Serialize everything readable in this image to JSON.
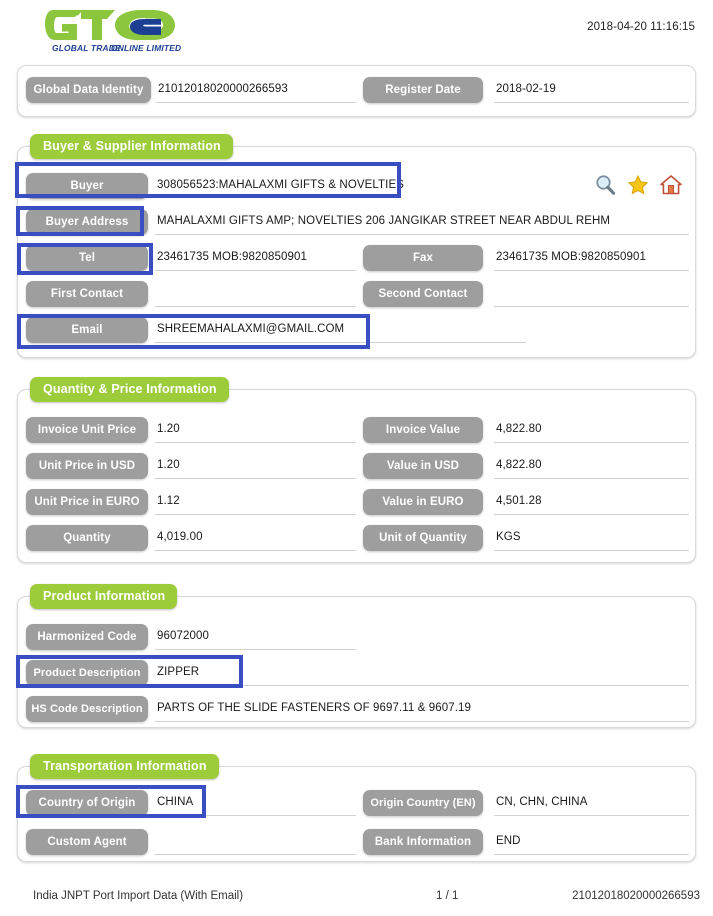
{
  "header": {
    "logo_text_top": "GTO",
    "logo_tagline": "GLOBAL TRADE ONLINE LIMITED",
    "timestamp": "2018-04-20 11:16:15"
  },
  "identity_card": {
    "fields": [
      {
        "label": "Global Data Identity",
        "value": "21012018020000266593"
      },
      {
        "label": "Register Date",
        "value": "2018-02-19"
      }
    ]
  },
  "buyer_section": {
    "title": "Buyer & Supplier Information",
    "fields": [
      {
        "label": "Buyer",
        "value": "308056523:MAHALAXMI GIFTS & NOVELTIES"
      },
      {
        "label": "Buyer Address",
        "value": "MAHALAXMI GIFTS AMP; NOVELTIES 206 JANGIKAR STREET NEAR ABDUL REHM"
      },
      {
        "label": "Tel",
        "value": "23461735 MOB:9820850901"
      },
      {
        "label": "Fax",
        "value": "23461735 MOB:9820850901"
      },
      {
        "label": "First Contact",
        "value": ""
      },
      {
        "label": "Second Contact",
        "value": ""
      },
      {
        "label": "Email",
        "value": "SHREEMAHALAXMI@GMAIL.COM"
      }
    ],
    "actions": [
      {
        "name": "search-icon",
        "title": "Search"
      },
      {
        "name": "star-icon",
        "title": "Favorite"
      },
      {
        "name": "home-icon",
        "title": "Home"
      }
    ]
  },
  "quantity_section": {
    "title": "Quantity & Price Information",
    "fields": [
      {
        "label": "Invoice Unit Price",
        "value": "1.20"
      },
      {
        "label": "Invoice Value",
        "value": "4,822.80"
      },
      {
        "label": "Unit Price in USD",
        "value": "1.20"
      },
      {
        "label": "Value in USD",
        "value": "4,822.80"
      },
      {
        "label": "Unit Price in EURO",
        "value": "1.12"
      },
      {
        "label": "Value in EURO",
        "value": "4,501.28"
      },
      {
        "label": "Quantity",
        "value": "4,019.00"
      },
      {
        "label": "Unit of Quantity",
        "value": "KGS"
      }
    ]
  },
  "product_section": {
    "title": "Product Information",
    "fields": [
      {
        "label": "Harmonized Code",
        "value": "96072000"
      },
      {
        "label": "Product Description",
        "value": "ZIPPER"
      },
      {
        "label": "HS Code Description",
        "value": "PARTS OF THE SLIDE FASTENERS OF 9697.11 & 9607.19"
      }
    ]
  },
  "transport_section": {
    "title": "Transportation Information",
    "fields": [
      {
        "label": "Country of Origin",
        "value": "CHINA"
      },
      {
        "label": "Origin Country (EN)",
        "value": "CN, CHN, CHINA"
      },
      {
        "label": "Custom Agent",
        "value": ""
      },
      {
        "label": "Bank Information",
        "value": "END"
      }
    ]
  },
  "footer": {
    "source": "India JNPT Port Import Data (With Email)",
    "page": "1 / 1",
    "record_id": "21012018020000266593"
  },
  "colors": {
    "section_green": "#9dcc3b",
    "label_gray": "#9e9e9e",
    "highlight_blue": "#3a4ec4",
    "logo_green": "#8cc63f",
    "logo_blue": "#1c3f94"
  }
}
